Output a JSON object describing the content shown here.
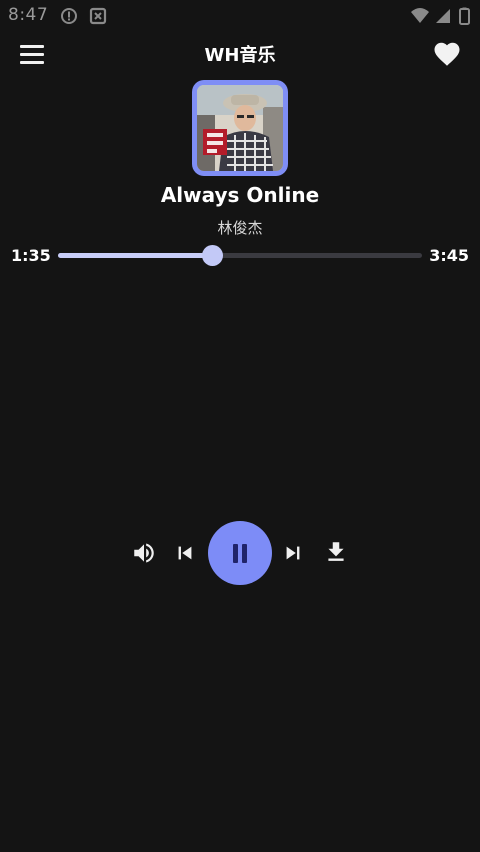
{
  "status_bar": {
    "time": "8:47"
  },
  "app_bar": {
    "title": "WH音乐",
    "menu_icon": "menu-icon",
    "favorite_icon": "heart-icon"
  },
  "now_playing": {
    "title": "Always Online",
    "artist": "林俊杰",
    "current_time": "1:35",
    "total_time": "3:45",
    "progress": 0.422
  },
  "controls": {
    "volume_icon": "volume-icon",
    "previous_icon": "skip-previous-icon",
    "play_state": "playing",
    "pause_icon": "pause-icon",
    "next_icon": "skip-next-icon",
    "download_icon": "download-icon"
  },
  "colors": {
    "background": "#141414",
    "accent": "#7d8cf7",
    "progress_fill": "#c8cdf8",
    "track": "#3a3a40"
  }
}
